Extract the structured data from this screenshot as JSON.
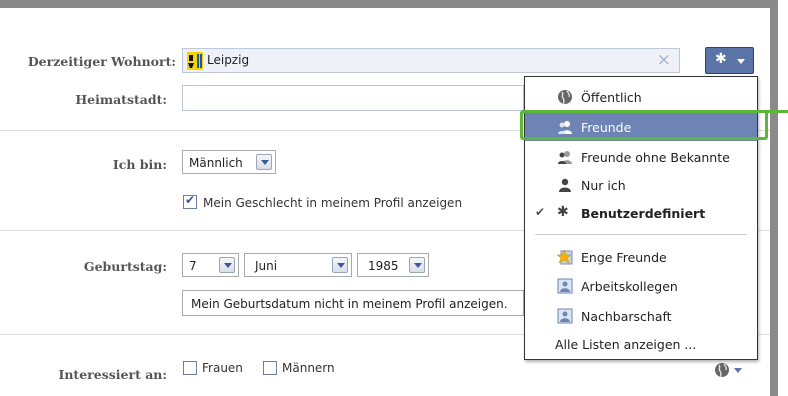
{
  "form": {
    "wohnort_label": "Derzeitiger Wohnort:",
    "wohnort_value": "Leipzig",
    "heimatstadt_label": "Heimatstadt:",
    "heimatstadt_value": "",
    "ich_bin_label": "Ich bin:",
    "gender_value": "Männlich",
    "show_gender_label": "Mein Geschlecht in meinem Profil anzeigen",
    "show_gender_checked": true,
    "geburtstag_label": "Geburtstag:",
    "birth_day": "7",
    "birth_month": "Juni",
    "birth_year": "1985",
    "birth_display_option": "Mein Geburtsdatum nicht in meinem Profil anzeigen.",
    "interessiert_label": "Interessiert an:",
    "interest_women": "Frauen",
    "interest_men": "Männern"
  },
  "privacy_menu": {
    "items": [
      {
        "label": "Öffentlich",
        "icon": "globe-icon"
      },
      {
        "label": "Freunde",
        "icon": "friends-icon",
        "highlighted": true
      },
      {
        "label": "Freunde ohne Bekannte",
        "icon": "friends-except-icon"
      },
      {
        "label": "Nur ich",
        "icon": "lock-person-icon"
      },
      {
        "label": "Benutzerdefiniert",
        "icon": "gear-icon",
        "checked": true,
        "bold": true
      },
      {
        "label": "Enge Freunde",
        "icon": "star-icon"
      },
      {
        "label": "Arbeitskollegen",
        "icon": "list-icon"
      },
      {
        "label": "Nachbarschaft",
        "icon": "list-icon"
      },
      {
        "label": "Alle Listen anzeigen ...",
        "icon": ""
      }
    ]
  },
  "colors": {
    "accent": "#5b74a8",
    "menu_highlight": "#6d84b4",
    "callout": "#5cb83a"
  }
}
